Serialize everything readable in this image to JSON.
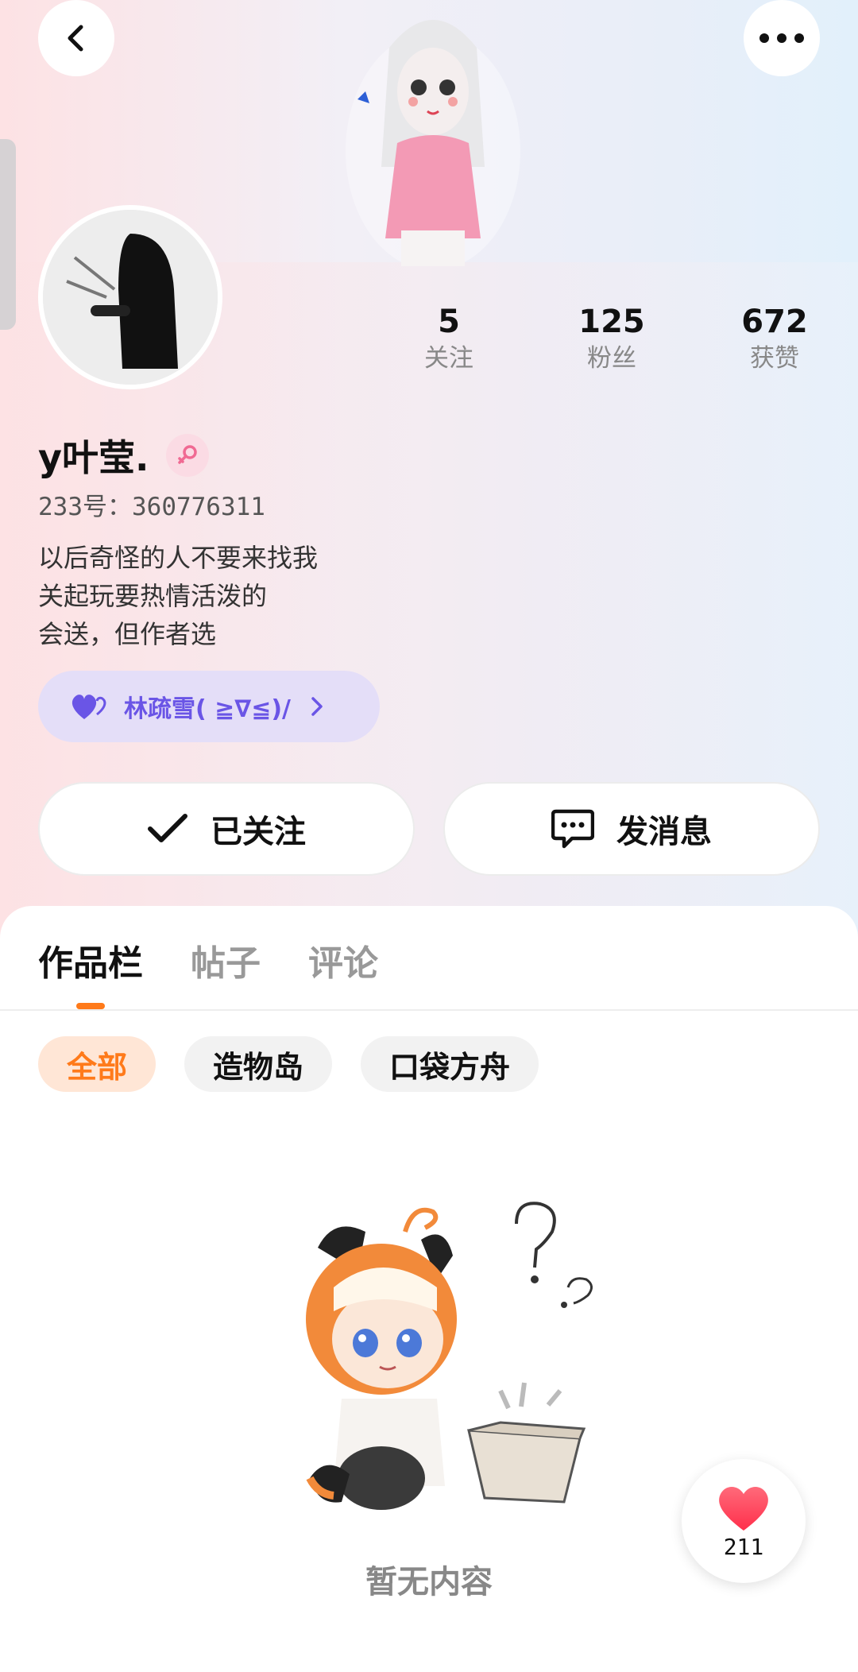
{
  "header": {
    "back_icon": "chevron-left-icon",
    "more_icon": "more-horizontal-icon"
  },
  "profile": {
    "name": "y叶莹.",
    "gender_icon": "female-icon",
    "uid": "233号：360776311",
    "bio": [
      "以后奇怪的人不要来找我",
      "关起玩要热情活泼的",
      "会送，但作者选"
    ],
    "stats": [
      {
        "value": "5",
        "label": "关注"
      },
      {
        "value": "125",
        "label": "粉丝"
      },
      {
        "value": "672",
        "label": "获赞"
      }
    ],
    "tag": {
      "icon": "hearts-icon",
      "text": "林疏雪( ≧∇≦)/",
      "chevron": "chevron-right-icon"
    }
  },
  "actions": {
    "follow_label": "已关注",
    "message_label": "发消息"
  },
  "tabs": [
    "作品栏",
    "帖子",
    "评论"
  ],
  "filters": [
    "全部",
    "造物岛",
    "口袋方舟"
  ],
  "empty": {
    "text": "暂无内容"
  },
  "like_fab": {
    "count": "211"
  },
  "colors": {
    "accent": "#ff7a1a",
    "tag_text": "#6a55e6",
    "tag_bg": "#e4def8",
    "heart": "#ff3b55"
  }
}
